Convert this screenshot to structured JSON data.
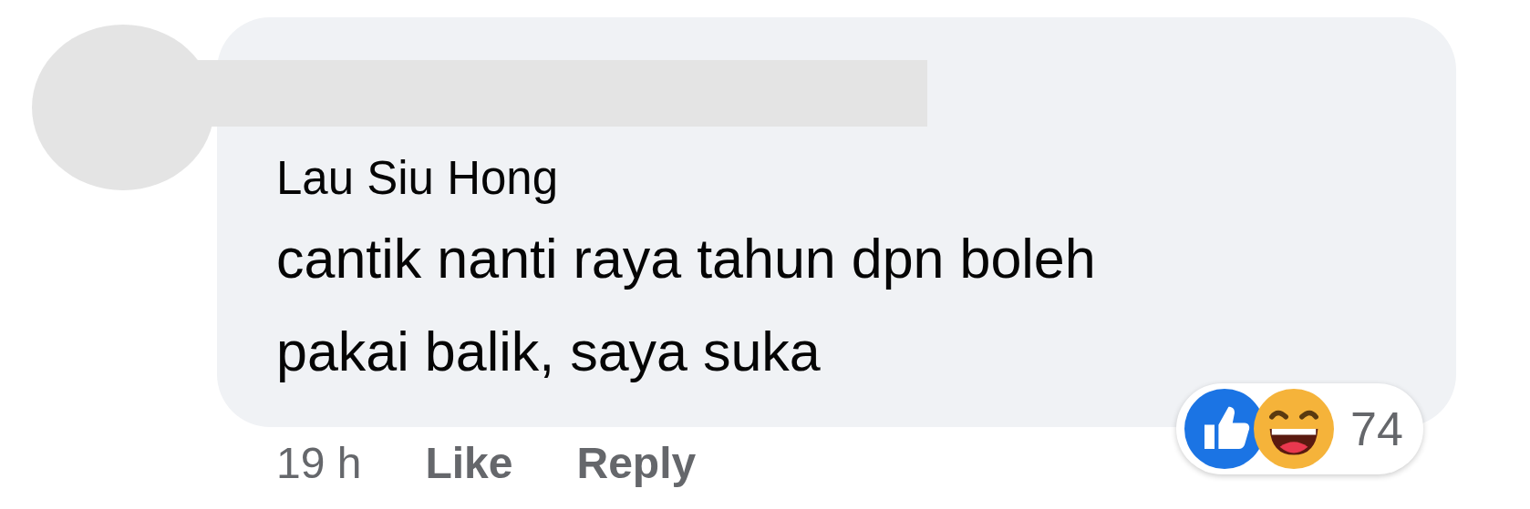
{
  "comment": {
    "author": "Lau Siu Hong",
    "text": "cantik nanti raya tahun dpn boleh pakai balik, saya suka"
  },
  "footer": {
    "time": "19 h",
    "actions": [
      "Like",
      "Reply"
    ]
  },
  "reactions": {
    "count": "74"
  }
}
